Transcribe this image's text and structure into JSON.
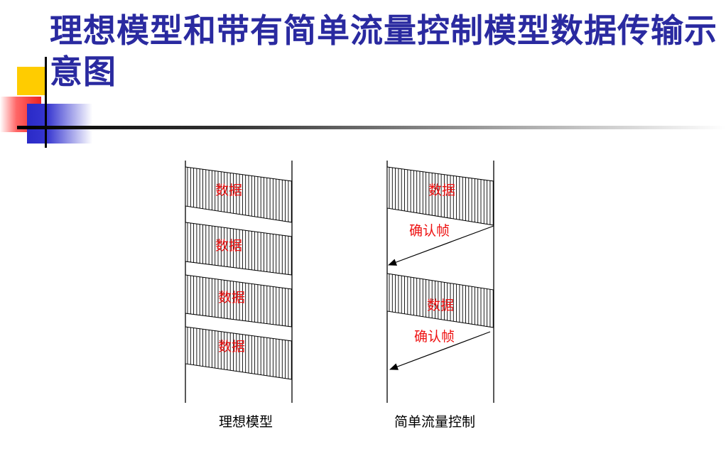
{
  "slide": {
    "title": "理想模型和带有简单流量控制模型数据传输示意图"
  },
  "diagram": {
    "ideal_model": {
      "caption": "理想模型",
      "frames": [
        "数据",
        "数据",
        "数据",
        "数据"
      ]
    },
    "flow_control_model": {
      "caption": "简单流量控制",
      "frames": [
        "数据",
        "数据"
      ],
      "acks": [
        "确认帧",
        "确认帧"
      ]
    }
  }
}
